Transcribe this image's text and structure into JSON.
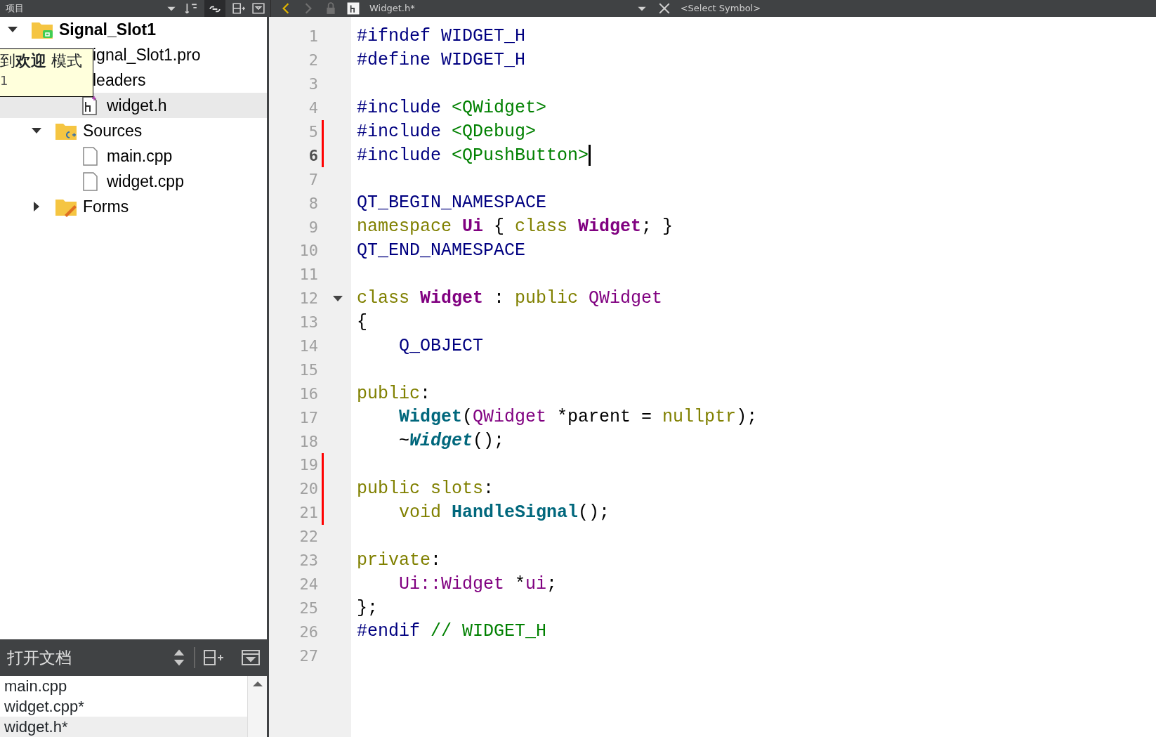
{
  "toolbar": {
    "project_label": "项目",
    "file_label": "Widget.h*",
    "symbol_label": "<Select Symbol>"
  },
  "tree": [
    {
      "label": "Signal_Slot1",
      "kind": "qt-project",
      "bold": true,
      "expanded": true,
      "selected": false,
      "children": [
        {
          "label": "ignal_Slot1.pro",
          "selected": false
        },
        {
          "label": "leaders",
          "selected": false,
          "children": [
            {
              "label": "widget.h",
              "kind": "header",
              "selected": true
            }
          ]
        },
        {
          "label": "Sources",
          "kind": "cpp-folder",
          "expanded": true,
          "selected": false,
          "children": [
            {
              "label": "main.cpp",
              "kind": "file",
              "selected": false
            },
            {
              "label": "widget.cpp",
              "kind": "file",
              "selected": false
            }
          ]
        },
        {
          "label": "Forms",
          "kind": "forms-folder",
          "expanded": false,
          "selected": false
        }
      ]
    }
  ],
  "tooltip": {
    "lines": [
      "到**欢迎** 模式",
      "1"
    ]
  },
  "open_documents": {
    "title": "打开文档",
    "items": [
      {
        "label": "main.cpp",
        "selected": false
      },
      {
        "label": "widget.cpp*",
        "selected": false
      },
      {
        "label": "widget.h*",
        "selected": true
      }
    ]
  },
  "editor": {
    "lines": [
      {
        "number": "1",
        "changed": false,
        "current": false,
        "fold": false,
        "indented": false,
        "tokens": [
          {
            "kind": "preproc",
            "text": "#ifndef WIDGET_H"
          }
        ]
      },
      {
        "number": "2",
        "changed": false,
        "current": false,
        "fold": false,
        "indented": false,
        "tokens": [
          {
            "kind": "preproc",
            "text": "#define WIDGET_H"
          }
        ]
      },
      {
        "number": "3",
        "changed": false,
        "current": false,
        "fold": false
      },
      {
        "number": "4",
        "changed": false,
        "current": false,
        "fold": false,
        "indented": false,
        "tokens": [
          {
            "kind": "preproc",
            "text": "#include "
          },
          {
            "kind": "include",
            "text": "<QWidget>"
          }
        ]
      },
      {
        "number": "5",
        "changed": true,
        "current": false,
        "fold": false,
        "indented": false,
        "tokens": [
          {
            "kind": "preproc",
            "text": "#include "
          },
          {
            "kind": "include",
            "text": "<QDebug>"
          }
        ]
      },
      {
        "number": "6",
        "changed": true,
        "current": true,
        "fold": false,
        "indented": false,
        "tokens": [
          {
            "kind": "preproc",
            "text": "#include "
          },
          {
            "kind": "include",
            "text": "<QPushButton>"
          }
        ]
      },
      {
        "number": "7",
        "changed": false,
        "current": false,
        "fold": false
      },
      {
        "number": "8",
        "changed": false,
        "current": false,
        "fold": false,
        "indented": false,
        "tokens": [
          {
            "kind": "macro",
            "text": "QT_BEGIN_NAMESPACE"
          }
        ]
      },
      {
        "number": "9",
        "changed": false,
        "current": false,
        "fold": false,
        "indented": false,
        "tokens": [
          {
            "kind": "keyword",
            "text": "namespace "
          },
          {
            "kind": "typedecl",
            "text": "Ui"
          },
          {
            "kind": "text",
            "text": " { "
          },
          {
            "kind": "keyword",
            "text": "class "
          },
          {
            "kind": "typedecl",
            "text": "Widget"
          },
          {
            "kind": "text",
            "text": "; }"
          }
        ]
      },
      {
        "number": "10",
        "changed": false,
        "current": false,
        "fold": false,
        "indented": false,
        "tokens": [
          {
            "kind": "macro",
            "text": "QT_END_NAMESPACE"
          }
        ]
      },
      {
        "number": "11",
        "changed": false,
        "current": false,
        "fold": false
      },
      {
        "number": "12",
        "changed": false,
        "current": false,
        "fold": true,
        "indented": false,
        "tokens": [
          {
            "kind": "keyword",
            "text": "class "
          },
          {
            "kind": "typedecl",
            "text": "Widget"
          },
          {
            "kind": "text",
            "text": " : "
          },
          {
            "kind": "keyword",
            "text": "public "
          },
          {
            "kind": "type",
            "text": "QWidget"
          }
        ]
      },
      {
        "number": "13",
        "changed": false,
        "current": false,
        "fold": false,
        "indented": false,
        "tokens": [
          {
            "kind": "text",
            "text": "{"
          }
        ]
      },
      {
        "number": "14",
        "changed": false,
        "current": false,
        "fold": false,
        "indented": true,
        "tokens": [
          {
            "kind": "macro",
            "text": "Q_OBJECT"
          }
        ]
      },
      {
        "number": "15",
        "changed": false,
        "current": false,
        "fold": false
      },
      {
        "number": "16",
        "changed": false,
        "current": false,
        "fold": false,
        "indented": false,
        "tokens": [
          {
            "kind": "keyword",
            "text": "public"
          },
          {
            "kind": "text",
            "text": ":"
          }
        ]
      },
      {
        "number": "17",
        "changed": false,
        "current": false,
        "fold": false,
        "indented": true,
        "tokens": [
          {
            "kind": "func",
            "text": "Widget"
          },
          {
            "kind": "text",
            "text": "("
          },
          {
            "kind": "type",
            "text": "QWidget"
          },
          {
            "kind": "text",
            "text": " *parent = "
          },
          {
            "kind": "keyword",
            "text": "nullptr"
          },
          {
            "kind": "text",
            "text": ");"
          }
        ]
      },
      {
        "number": "18",
        "changed": false,
        "current": false,
        "fold": false,
        "indented": true,
        "tokens": [
          {
            "kind": "text",
            "text": "~"
          },
          {
            "kind": "func-italic",
            "text": "Widget"
          },
          {
            "kind": "text",
            "text": "();"
          }
        ]
      },
      {
        "number": "19",
        "changed": true,
        "current": false,
        "fold": false
      },
      {
        "number": "20",
        "changed": true,
        "current": false,
        "fold": false,
        "indented": false,
        "tokens": [
          {
            "kind": "keyword",
            "text": "public slots"
          },
          {
            "kind": "text",
            "text": ":"
          }
        ]
      },
      {
        "number": "21",
        "changed": true,
        "current": false,
        "fold": false,
        "indented": true,
        "tokens": [
          {
            "kind": "keyword",
            "text": "void "
          },
          {
            "kind": "func",
            "text": "HandleSignal"
          },
          {
            "kind": "text",
            "text": "();"
          }
        ]
      },
      {
        "number": "22",
        "changed": false,
        "current": false,
        "fold": false
      },
      {
        "number": "23",
        "changed": false,
        "current": false,
        "fold": false,
        "indented": false,
        "tokens": [
          {
            "kind": "keyword",
            "text": "private"
          },
          {
            "kind": "text",
            "text": ":"
          }
        ]
      },
      {
        "number": "24",
        "changed": false,
        "current": false,
        "fold": false,
        "indented": true,
        "tokens": [
          {
            "kind": "type",
            "text": "Ui::Widget"
          },
          {
            "kind": "text",
            "text": " *"
          },
          {
            "kind": "type",
            "text": "ui"
          },
          {
            "kind": "text",
            "text": ";"
          }
        ]
      },
      {
        "number": "25",
        "changed": false,
        "current": false,
        "fold": false,
        "indented": false,
        "tokens": [
          {
            "kind": "text",
            "text": "};"
          }
        ]
      },
      {
        "number": "26",
        "changed": false,
        "current": false,
        "fold": false,
        "indented": false,
        "tokens": [
          {
            "kind": "preproc",
            "text": "#endif "
          },
          {
            "kind": "comment",
            "text": "// WIDGET_H"
          }
        ]
      },
      {
        "number": "27",
        "changed": false,
        "current": false,
        "fold": false
      }
    ]
  }
}
